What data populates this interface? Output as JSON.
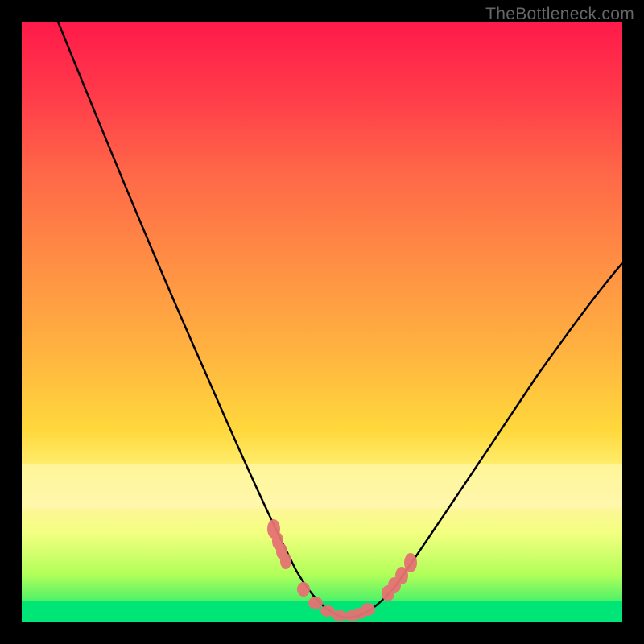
{
  "watermark": "TheBottleneck.com",
  "chart_data": {
    "type": "line",
    "title": "",
    "xlabel": "",
    "ylabel": "",
    "xlim": [
      0,
      100
    ],
    "ylim": [
      0,
      100
    ],
    "series": [
      {
        "name": "curve",
        "x": [
          6,
          10,
          15,
          20,
          25,
          30,
          35,
          40,
          43,
          46,
          49,
          52,
          55,
          58,
          62,
          68,
          75,
          82,
          90,
          100
        ],
        "y": [
          100,
          90,
          78,
          66,
          54,
          42,
          30,
          19,
          12,
          7,
          3,
          1,
          0.5,
          1,
          3,
          9,
          18,
          28,
          39,
          52
        ]
      }
    ],
    "markers": {
      "name": "points",
      "x": [
        42,
        42.5,
        43,
        43.5,
        47,
        49,
        51,
        53,
        55,
        56,
        57,
        61,
        62,
        63,
        64.5
      ],
      "y": [
        15,
        13.5,
        12,
        11,
        5,
        2.5,
        1.2,
        0.8,
        0.8,
        1,
        1.3,
        4,
        5,
        6,
        8
      ]
    },
    "background_gradient": [
      "#ff1744",
      "#ff5252",
      "#ff8a50",
      "#ffb142",
      "#ffd740",
      "#fff176",
      "#eeff41",
      "#76ff03",
      "#00e676"
    ],
    "highlight_bands": [
      {
        "y_range": [
          70,
          79
        ],
        "color": "#fff59d"
      },
      {
        "y_range": [
          92,
          100
        ],
        "color": "#00e676"
      }
    ]
  }
}
